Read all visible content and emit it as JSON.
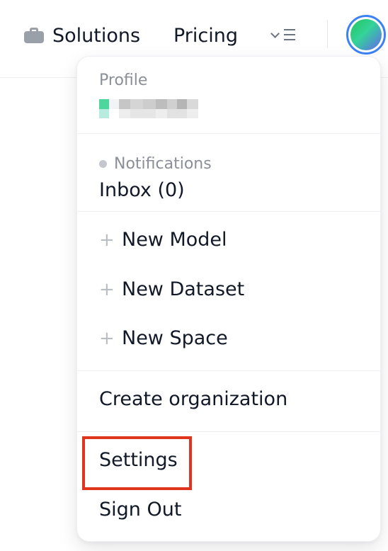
{
  "nav": {
    "solutions_label": "Solutions",
    "solutions_icon": "briefcase-icon",
    "pricing_label": "Pricing",
    "menu_icon": "chevron-list-icon"
  },
  "user": {
    "avatar_colors": [
      "#22c55e",
      "#34d399",
      "#6366f1"
    ],
    "ring_color": "#3b82f6"
  },
  "dropdown": {
    "profile_caption": "Profile",
    "notifications_caption": "Notifications",
    "inbox_label": "Inbox (0)",
    "new_items": [
      {
        "icon": "plus-icon",
        "label": "New Model"
      },
      {
        "icon": "plus-icon",
        "label": "New Dataset"
      },
      {
        "icon": "plus-icon",
        "label": "New Space"
      }
    ],
    "create_org_label": "Create organization",
    "settings_label": "Settings",
    "sign_out_label": "Sign Out"
  },
  "highlight": {
    "target": "settings",
    "color": "#e0341c"
  }
}
